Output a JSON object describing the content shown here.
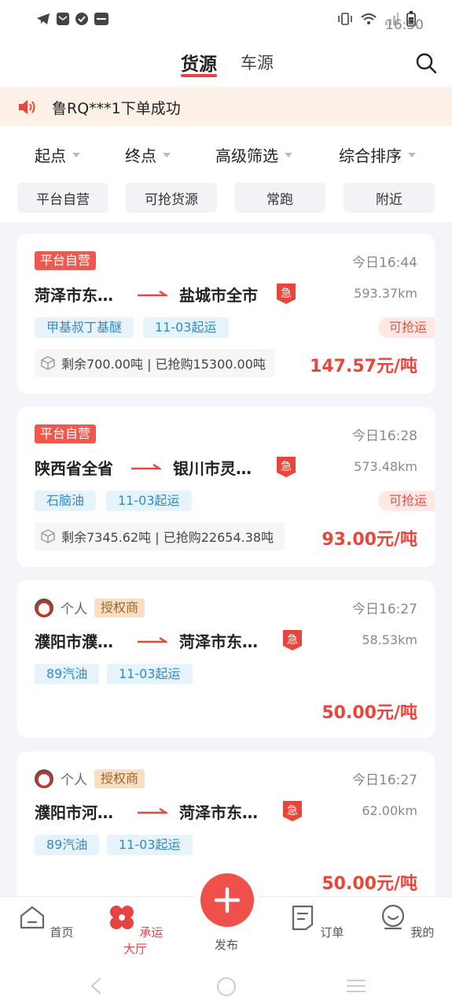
{
  "status": {
    "time": "16:50"
  },
  "header": {
    "tab_active": "货源",
    "tab_other": "车源"
  },
  "notice": {
    "text": "鲁RQ***1下单成功"
  },
  "filters": {
    "items": [
      "起点",
      "终点",
      "高级筛选",
      "综合排序"
    ]
  },
  "chips": [
    "平台自营",
    "可抢货源",
    "常跑",
    "附近"
  ],
  "cards": [
    {
      "tag": "平台自营",
      "time": "今日16:44",
      "from": "菏泽市东…",
      "to": "盐城市全市",
      "distance": "593.37km",
      "goods": "甲基叔丁基醚",
      "date": "11-03起运",
      "grab": "可抢运",
      "stock": "剩余700.00吨 | 已抢购15300.00吨",
      "price": "147.57元/吨"
    },
    {
      "tag": "平台自营",
      "time": "今日16:28",
      "from": "陕西省全省",
      "to": "银川市灵…",
      "distance": "573.48km",
      "goods": "石脑油",
      "date": "11-03起运",
      "grab": "可抢运",
      "stock": "剩余7345.62吨 | 已抢购22654.38吨",
      "price": "93.00元/吨"
    },
    {
      "person": "个人",
      "auth": "授权商",
      "time": "今日16:27",
      "from": "濮阳市濮…",
      "to": "菏泽市东…",
      "distance": "58.53km",
      "goods": "89汽油",
      "date": "11-03起运",
      "price": "50.00元/吨"
    },
    {
      "person": "个人",
      "auth": "授权商",
      "time": "今日16:27",
      "from": "濮阳市河…",
      "to": "菏泽市东…",
      "distance": "62.00km",
      "goods": "89汽油",
      "date": "11-03起运",
      "price": "50.00元/吨"
    }
  ],
  "tabbar": {
    "home": "首页",
    "hall": "承运大厅",
    "publish": "发布",
    "orders": "订单",
    "mine": "我的"
  },
  "colors": {
    "accent": "#e64343",
    "price": "#e8463b",
    "goods_tag": "#2f8bc8"
  }
}
